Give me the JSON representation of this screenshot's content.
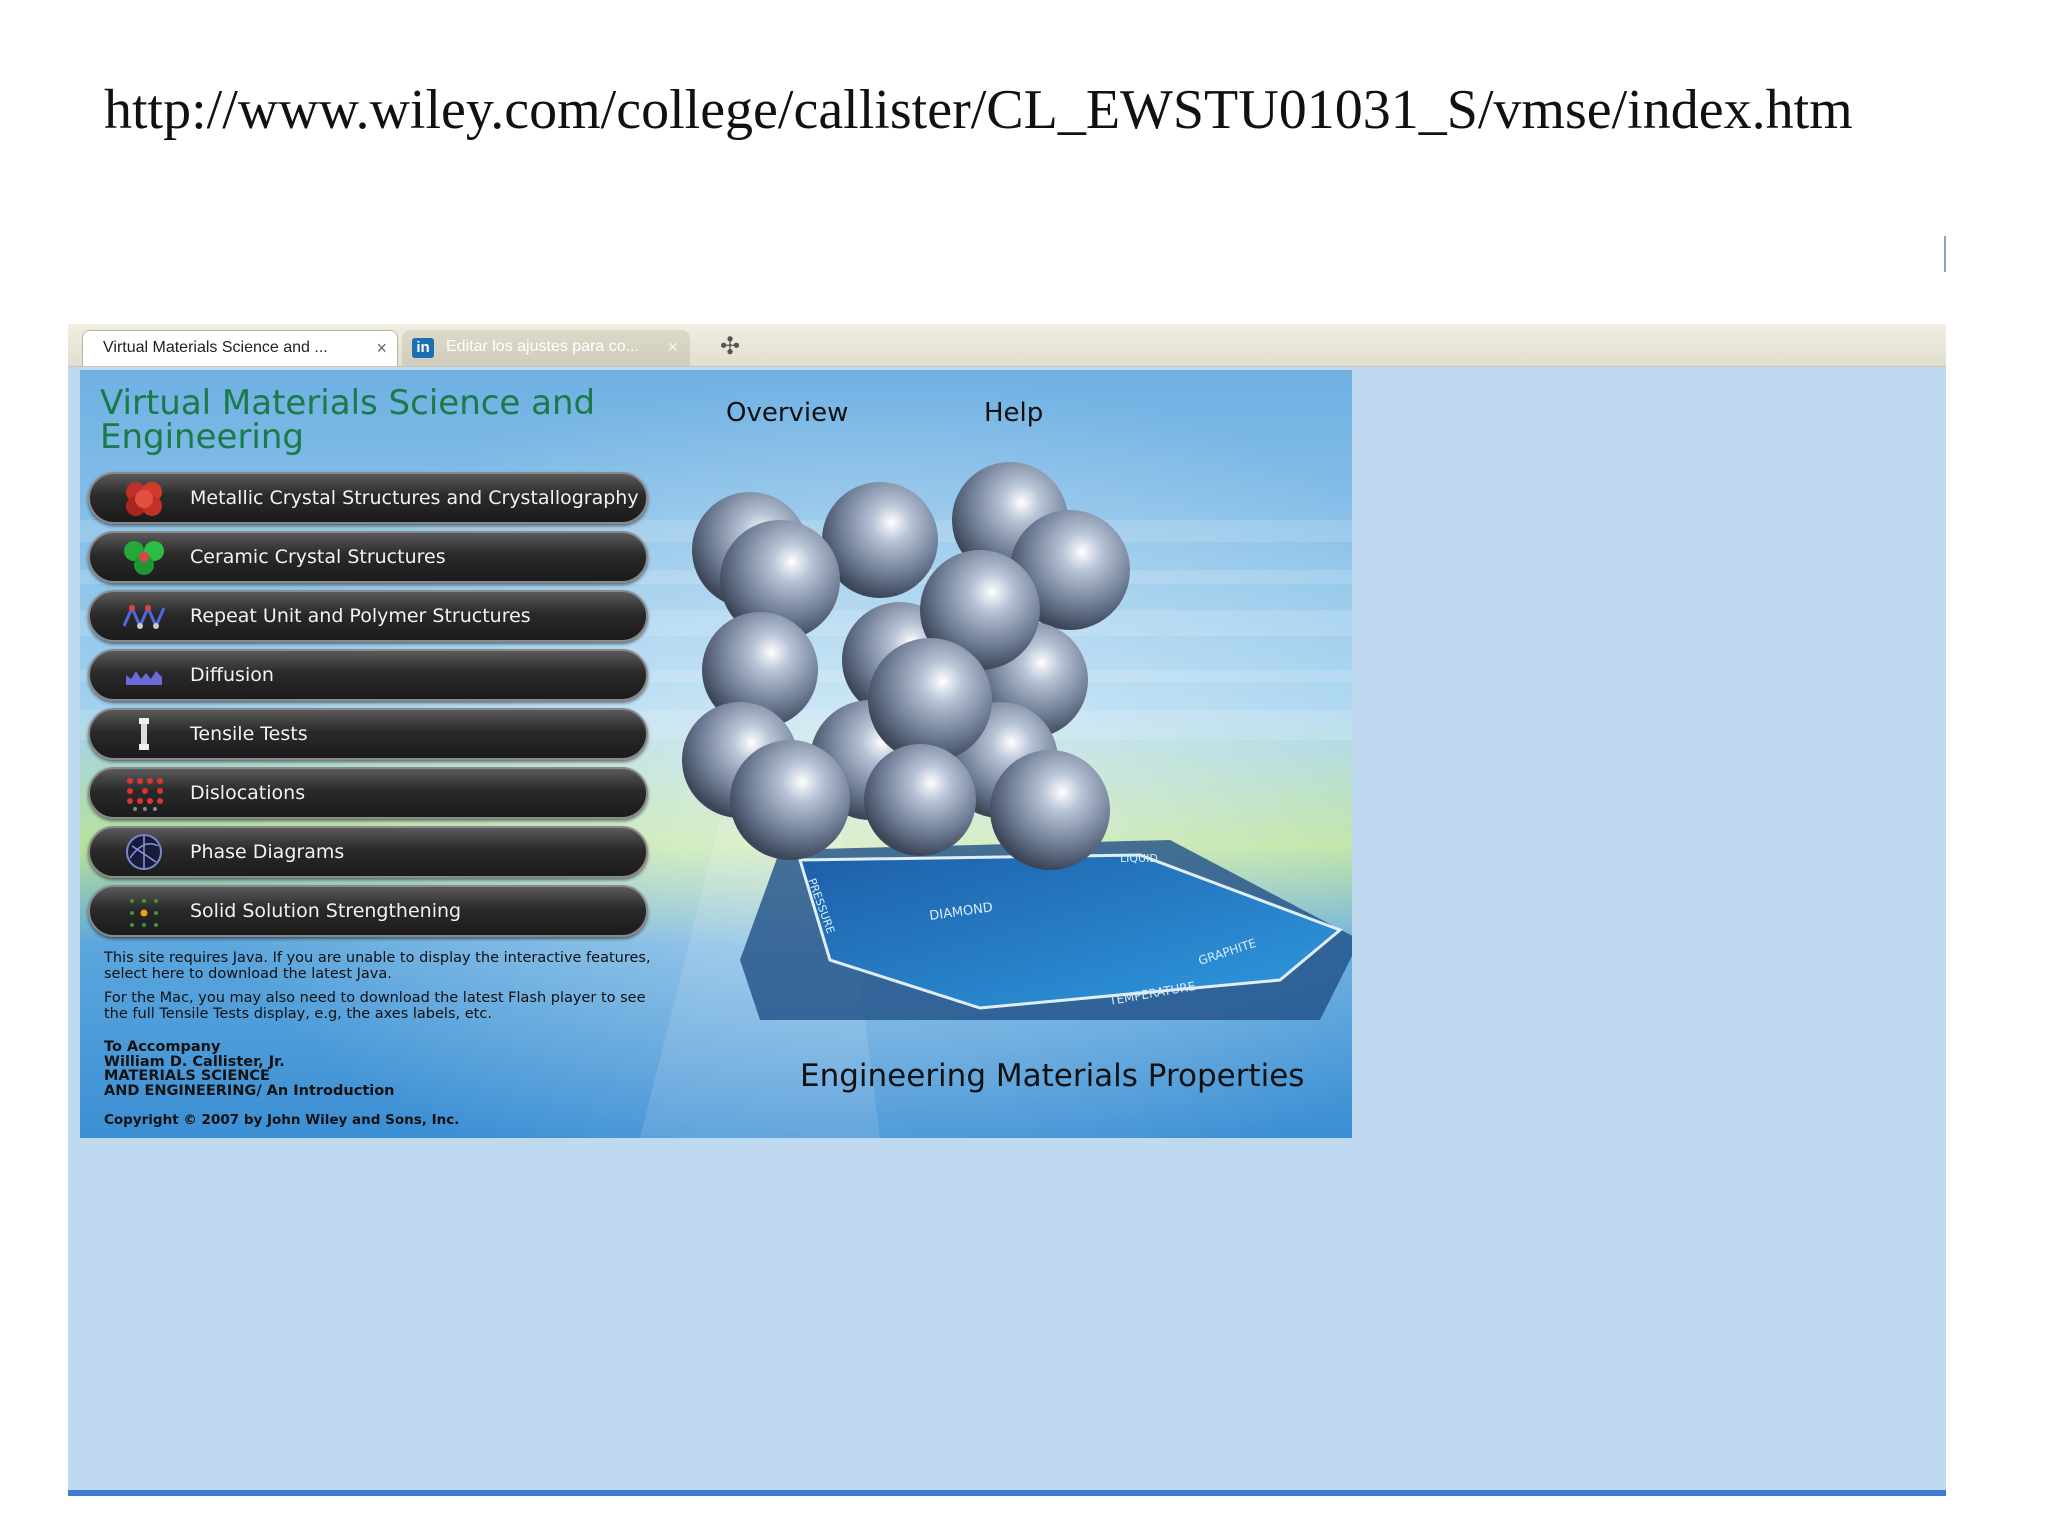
{
  "slide": {
    "url_text": "http://www.wiley.com/college/callister/CL_EWSTU01031_S/vmse/index.htm"
  },
  "browser": {
    "tabs": [
      {
        "label": "Virtual Materials Science and ...",
        "active": true
      },
      {
        "label": "Editar los ajustes para co...",
        "active": false,
        "icon": "linkedin-icon"
      }
    ],
    "close_glyph": "×",
    "new_tab_glyph": "✣"
  },
  "vmse": {
    "title": "Virtual Materials Science and Engineering",
    "nav": {
      "overview": "Overview",
      "help": "Help"
    },
    "menu": [
      {
        "label": "Metallic Crystal Structures and Crystallography",
        "icon": "metal-spheres-icon"
      },
      {
        "label": "Ceramic Crystal Structures",
        "icon": "ceramic-spheres-icon"
      },
      {
        "label": "Repeat Unit and Polymer Structures",
        "icon": "polymer-chain-icon"
      },
      {
        "label": "Diffusion",
        "icon": "diffusion-icon"
      },
      {
        "label": "Tensile Tests",
        "icon": "tensile-specimen-icon"
      },
      {
        "label": "Dislocations",
        "icon": "dislocation-lattice-icon"
      },
      {
        "label": "Phase Diagrams",
        "icon": "phase-diagram-icon"
      },
      {
        "label": "Solid Solution Strengthening",
        "icon": "solid-solution-icon"
      }
    ],
    "notes": {
      "java": "This site requires Java.  If you are unable to display the interactive features, select here to download the latest Java.",
      "flash": "For the Mac, you may also need to download the latest Flash player to see the full Tensile Tests display, e.g, the axes labels, etc."
    },
    "accompany": {
      "line1": "To Accompany",
      "line2": "William D. Callister, Jr.",
      "line3": "MATERIALS SCIENCE",
      "line4": "AND ENGINEERING/ An Introduction"
    },
    "copyright": "Copyright © 2007 by John Wiley and Sons, Inc.",
    "subtitle": "Engineering Materials Properties",
    "diagram_labels": {
      "diamond": "DIAMOND",
      "graphite": "GRAPHITE",
      "liquid": "LIQUID",
      "temperature": "TEMPERATURE",
      "pressure": "PRESSURE"
    }
  },
  "colors": {
    "title_green": "#1a7a48",
    "page_bg": "#bed9f0",
    "accent_bar": "#3d7bd1"
  }
}
